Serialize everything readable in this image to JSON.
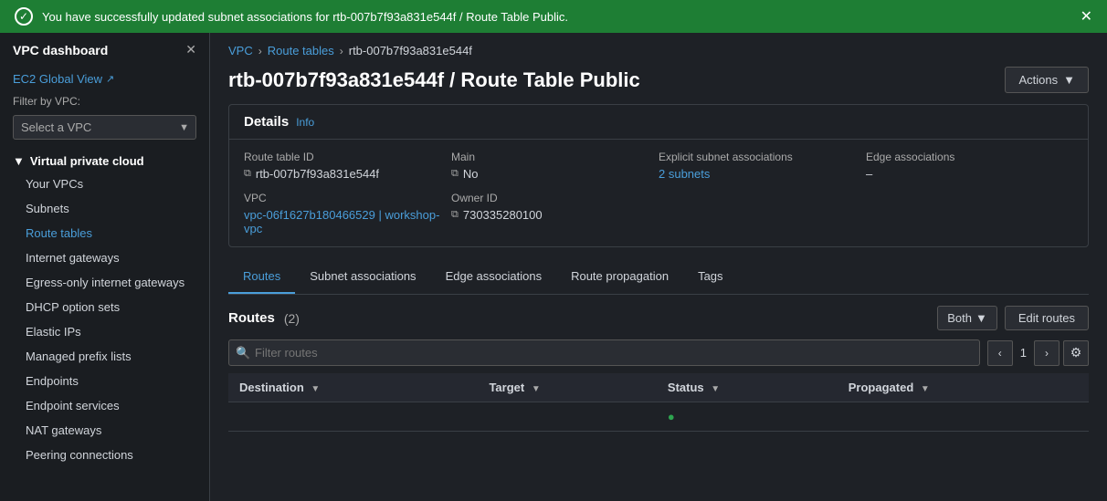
{
  "banner": {
    "message": "You have successfully updated subnet associations for rtb-007b7f93a831e544f / Route Table Public.",
    "type": "success"
  },
  "sidebar": {
    "title": "VPC dashboard",
    "filter_label": "Filter by VPC:",
    "filter_placeholder": "Select a VPC",
    "external_link_label": "EC2 Global View",
    "section_label": "Virtual private cloud",
    "items": [
      {
        "label": "Your VPCs",
        "active": false
      },
      {
        "label": "Subnets",
        "active": false
      },
      {
        "label": "Route tables",
        "active": true
      },
      {
        "label": "Internet gateways",
        "active": false
      },
      {
        "label": "Egress-only internet gateways",
        "active": false
      },
      {
        "label": "DHCP option sets",
        "active": false
      },
      {
        "label": "Elastic IPs",
        "active": false
      },
      {
        "label": "Managed prefix lists",
        "active": false
      },
      {
        "label": "Endpoints",
        "active": false
      },
      {
        "label": "Endpoint services",
        "active": false
      },
      {
        "label": "NAT gateways",
        "active": false
      },
      {
        "label": "Peering connections",
        "active": false
      }
    ]
  },
  "breadcrumb": {
    "vpc_label": "VPC",
    "route_tables_label": "Route tables",
    "current": "rtb-007b7f93a831e544f"
  },
  "page": {
    "title": "rtb-007b7f93a831e544f / Route Table Public",
    "actions_label": "Actions"
  },
  "details": {
    "section_title": "Details",
    "info_label": "Info",
    "fields": {
      "route_table_id_label": "Route table ID",
      "route_table_id_value": "rtb-007b7f93a831e544f",
      "main_label": "Main",
      "main_value": "No",
      "explicit_subnet_label": "Explicit subnet associations",
      "explicit_subnet_value": "2 subnets",
      "edge_assoc_label": "Edge associations",
      "edge_assoc_value": "–",
      "vpc_label": "VPC",
      "vpc_value": "vpc-06f1627b180466529 | workshop-vpc",
      "owner_id_label": "Owner ID",
      "owner_id_value": "730335280100"
    }
  },
  "tabs": [
    {
      "label": "Routes",
      "active": true
    },
    {
      "label": "Subnet associations",
      "active": false
    },
    {
      "label": "Edge associations",
      "active": false
    },
    {
      "label": "Route propagation",
      "active": false
    },
    {
      "label": "Tags",
      "active": false
    }
  ],
  "routes_section": {
    "title": "Routes",
    "count": "(2)",
    "both_label": "Both",
    "edit_routes_label": "Edit routes",
    "filter_placeholder": "Filter routes",
    "page_number": "1",
    "table_headers": [
      {
        "label": "Destination"
      },
      {
        "label": "Target"
      },
      {
        "label": "Status"
      },
      {
        "label": "Propagated"
      }
    ]
  }
}
